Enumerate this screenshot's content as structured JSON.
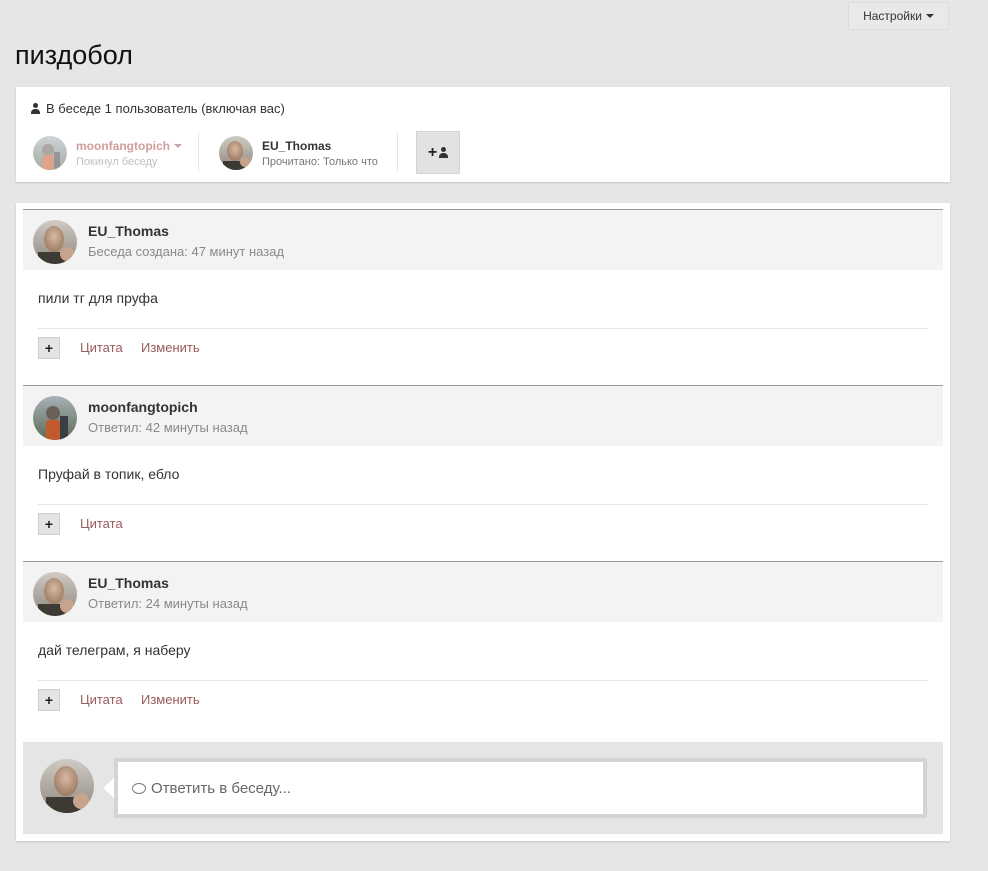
{
  "header": {
    "settings_label": "Настройки",
    "title": "пиздобол"
  },
  "participants": {
    "count_text": "В беседе 1 пользователь (включая вас)",
    "list": [
      {
        "name": "moonfangtopich",
        "status": "Покинул беседу",
        "state": "left"
      },
      {
        "name": "EU_Thomas",
        "status": "Прочитано: Только что",
        "state": "active"
      }
    ],
    "add_button_icon": "add-user-icon"
  },
  "messages": [
    {
      "author": "EU_Thomas",
      "meta": "Беседа создана: 47 минут назад",
      "body": "пили тг для пруфа",
      "quote_label": "Цитата",
      "edit_label": "Изменить"
    },
    {
      "author": "moonfangtopich",
      "meta": "Ответил: 42 минуты назад",
      "body": "Пруфай в топик, ебло",
      "quote_label": "Цитата"
    },
    {
      "author": "EU_Thomas",
      "meta": "Ответил: 24 минуты назад",
      "body": "дай телеграм, я наберу",
      "quote_label": "Цитата",
      "edit_label": "Изменить"
    }
  ],
  "reply": {
    "placeholder": "Ответить в беседу..."
  },
  "colors": {
    "background": "#e6e6e6",
    "link": "#9a5a5a",
    "left_user_name": "#d19e9e"
  }
}
